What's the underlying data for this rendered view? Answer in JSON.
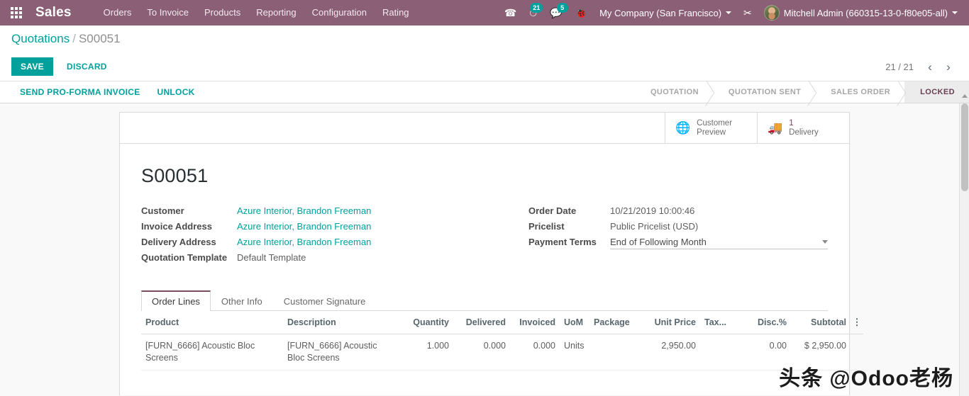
{
  "navbar": {
    "apps_icon": "apps-grid-icon",
    "brand": "Sales",
    "menu": [
      {
        "label": "Orders"
      },
      {
        "label": "To Invoice"
      },
      {
        "label": "Products"
      },
      {
        "label": "Reporting"
      },
      {
        "label": "Configuration"
      },
      {
        "label": "Rating"
      }
    ],
    "icons": {
      "phone": "☎",
      "activity": "⏱",
      "activity_badge": "21",
      "messaging": "💬",
      "messaging_badge": "5",
      "debug": "🐞"
    },
    "company": "My Company (San Francisco)",
    "shortcut_icon": "✂",
    "user": "Mitchell Admin (660315-13-0-f80e05-all)"
  },
  "control_panel": {
    "breadcrumb_root": "Quotations",
    "breadcrumb_sep": "/",
    "breadcrumb_current": "S00051",
    "save_label": "SAVE",
    "discard_label": "DISCARD",
    "pager": "21 / 21",
    "pager_prev": "‹",
    "pager_next": "›"
  },
  "statusbar": {
    "buttons": [
      {
        "label": "SEND PRO-FORMA INVOICE"
      },
      {
        "label": "UNLOCK"
      }
    ],
    "stages": [
      {
        "label": "QUOTATION",
        "active": false
      },
      {
        "label": "QUOTATION SENT",
        "active": false
      },
      {
        "label": "SALES ORDER",
        "active": false
      },
      {
        "label": "LOCKED",
        "active": true
      }
    ]
  },
  "smart_buttons": [
    {
      "icon": "globe-icon",
      "glyph": "🌐",
      "line1": "Customer",
      "line2": "Preview",
      "value": ""
    },
    {
      "icon": "truck-icon",
      "glyph": "🚚",
      "line1": "1",
      "line2": "Delivery",
      "value": "1"
    }
  ],
  "record": {
    "title": "S00051",
    "left_fields": [
      {
        "label": "Customer",
        "value": "Azure Interior, Brandon Freeman",
        "link": true
      },
      {
        "label": "Invoice Address",
        "value": "Azure Interior, Brandon Freeman",
        "link": true
      },
      {
        "label": "Delivery Address",
        "value": "Azure Interior, Brandon Freeman",
        "link": true
      },
      {
        "label": "Quotation Template",
        "value": "Default Template",
        "link": false
      }
    ],
    "right_fields": [
      {
        "label": "Order Date",
        "value": "10/21/2019 10:00:46"
      },
      {
        "label": "Pricelist",
        "value": "Public Pricelist (USD)"
      },
      {
        "label": "Payment Terms",
        "value": "End of Following Month"
      }
    ]
  },
  "notebook": {
    "tabs": [
      {
        "label": "Order Lines",
        "active": true
      },
      {
        "label": "Other Info",
        "active": false
      },
      {
        "label": "Customer Signature",
        "active": false
      }
    ]
  },
  "order_lines": {
    "columns": [
      {
        "label": "Product",
        "align": "left"
      },
      {
        "label": "Description",
        "align": "left"
      },
      {
        "label": "Quantity",
        "align": "right"
      },
      {
        "label": "Delivered",
        "align": "right"
      },
      {
        "label": "Invoiced",
        "align": "right"
      },
      {
        "label": "UoM",
        "align": "left"
      },
      {
        "label": "Package",
        "align": "left"
      },
      {
        "label": "Unit Price",
        "align": "right"
      },
      {
        "label": "Tax...",
        "align": "left"
      },
      {
        "label": "Disc.%",
        "align": "right"
      },
      {
        "label": "Subtotal",
        "align": "right"
      }
    ],
    "optional_columns_icon": "vertical-dots-icon",
    "rows": [
      {
        "product": "[FURN_6666] Acoustic Bloc Screens",
        "description": "[FURN_6666] Acoustic Bloc Screens",
        "quantity": "1.000",
        "delivered": "0.000",
        "invoiced": "0.000",
        "uom": "Units",
        "package": "",
        "unit_price": "2,950.00",
        "tax": "",
        "discount": "0.00",
        "subtotal": "$ 2,950.00"
      }
    ]
  },
  "watermark": "头条 @Odoo老杨",
  "colors": {
    "brand_purple": "#8b5f75",
    "accent_teal": "#00a09d",
    "stage_active_text": "#6b3d52",
    "page_bg": "#f9f9f9"
  }
}
